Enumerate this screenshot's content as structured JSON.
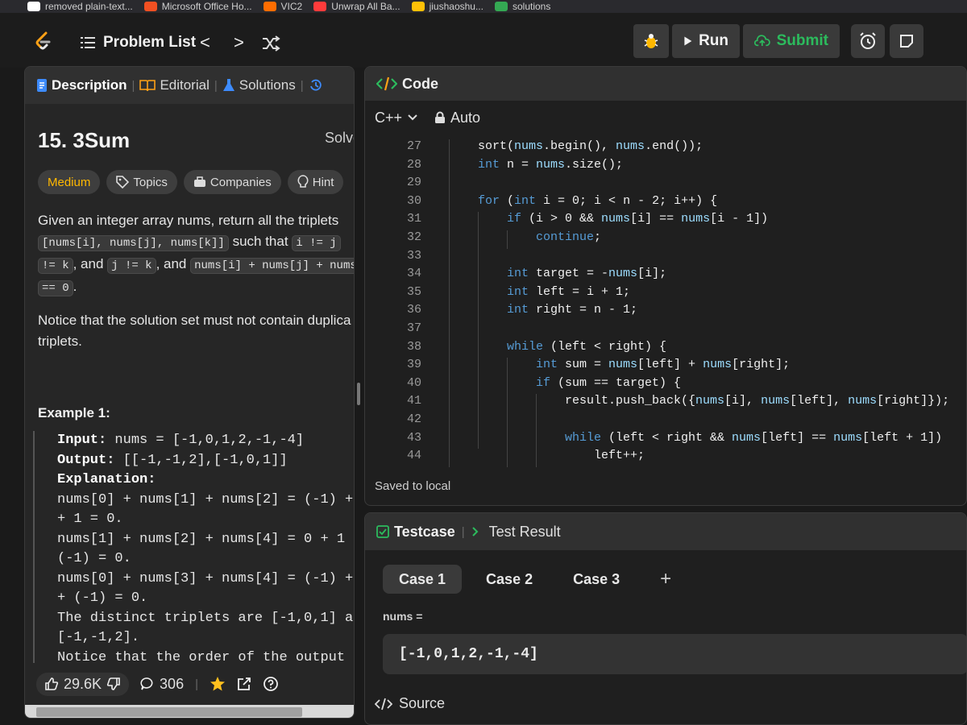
{
  "browser": {
    "bookmarks": [
      {
        "label": "removed plain-text...",
        "color": "#ffffff"
      },
      {
        "label": "Microsoft Office Ho...",
        "color": "#f25022"
      },
      {
        "label": "VIC2",
        "color": "#ff6d00"
      },
      {
        "label": "Unwrap All Ba...",
        "color": "#ff3b3b"
      },
      {
        "label": "jiushaoshu...",
        "color": "#ffc107"
      },
      {
        "label": "solutions",
        "color": "#34a853"
      }
    ]
  },
  "nav": {
    "problem_list": "Problem List",
    "prev": "<",
    "next": ">",
    "run": "Run",
    "submit": "Submit"
  },
  "left": {
    "tabs": {
      "description": "Description",
      "editorial": "Editorial",
      "solutions": "Solutions"
    },
    "title": "15. 3Sum",
    "solved": "Solve",
    "chips": {
      "difficulty": "Medium",
      "topics": "Topics",
      "companies": "Companies",
      "hint": "Hint"
    },
    "desc": {
      "p1": "Given an integer array nums, return all the triplets",
      "c1": "[nums[i], nums[j], nums[k]]",
      "t1": " such that ",
      "c2": "i != j",
      "t2": ", ",
      "c3": "!= k",
      "t3": ", and ",
      "c4": "j != k",
      "t4": ", and ",
      "c5": "nums[i] + nums[j] + nums",
      "c6": "== 0",
      "t5": "."
    },
    "notice": "Notice that the solution set must not contain duplica triplets.",
    "example_title": "Example 1:",
    "example": {
      "input_label": "Input:",
      "input_value": " nums = [-1,0,1,2,-1,-4]",
      "output_label": "Output:",
      "output_value": " [[-1,-1,2],[-1,0,1]]",
      "explanation_label": "Explanation:",
      "lines": [
        "nums[0] + nums[1] + nums[2] = (-1) +",
        "+ 1 = 0.",
        "nums[1] + nums[2] + nums[4] = 0 + 1",
        "(-1) = 0.",
        "nums[0] + nums[3] + nums[4] = (-1) +",
        "+ (-1) = 0.",
        "The distinct triplets are [-1,0,1] a",
        "[-1,-1,2].",
        "Notice that the order of the output"
      ]
    },
    "footer": {
      "likes": "29.6K",
      "comments": "306"
    }
  },
  "code": {
    "tab": "Code",
    "language": "C++",
    "mode": "Auto",
    "lines": [
      {
        "n": "27",
        "indent": 0,
        "html": "sort(nums.begin(), nums.end());"
      },
      {
        "n": "28",
        "indent": 0,
        "html": "int n = nums.size();"
      },
      {
        "n": "29",
        "indent": 0,
        "html": ""
      },
      {
        "n": "30",
        "indent": 0,
        "html": "for (int i = 0; i < n - 2; i++) {"
      },
      {
        "n": "31",
        "indent": 1,
        "html": "if (i > 0 && nums[i] == nums[i - 1])"
      },
      {
        "n": "32",
        "indent": 2,
        "html": "continue;"
      },
      {
        "n": "33",
        "indent": 0,
        "html": ""
      },
      {
        "n": "34",
        "indent": 1,
        "html": "int target = -nums[i];"
      },
      {
        "n": "35",
        "indent": 1,
        "html": "int left = i + 1;"
      },
      {
        "n": "36",
        "indent": 1,
        "html": "int right = n - 1;"
      },
      {
        "n": "37",
        "indent": 0,
        "html": ""
      },
      {
        "n": "38",
        "indent": 1,
        "html": "while (left < right) {"
      },
      {
        "n": "39",
        "indent": 2,
        "html": "int sum = nums[left] + nums[right];"
      },
      {
        "n": "40",
        "indent": 2,
        "html": "if (sum == target) {"
      },
      {
        "n": "41",
        "indent": 3,
        "html": "result.push_back({nums[i], nums[left], nums[right]});"
      },
      {
        "n": "42",
        "indent": 0,
        "html": ""
      },
      {
        "n": "43",
        "indent": 3,
        "html": "while (left < right && nums[left] == nums[left + 1])"
      },
      {
        "n": "44",
        "indent": 4,
        "html": "left++;"
      }
    ],
    "saved": "Saved to local"
  },
  "test": {
    "tab_testcase": "Testcase",
    "tab_result": "Test Result",
    "cases": [
      "Case 1",
      "Case 2",
      "Case 3"
    ],
    "add": "+",
    "nums_label": "nums =",
    "nums_value": "[-1,0,1,2,-1,-4]",
    "source": "Source"
  },
  "colors": {
    "accent_green": "#2cbb5d",
    "medium": "#ffb800",
    "keyword": "#569cd6"
  }
}
